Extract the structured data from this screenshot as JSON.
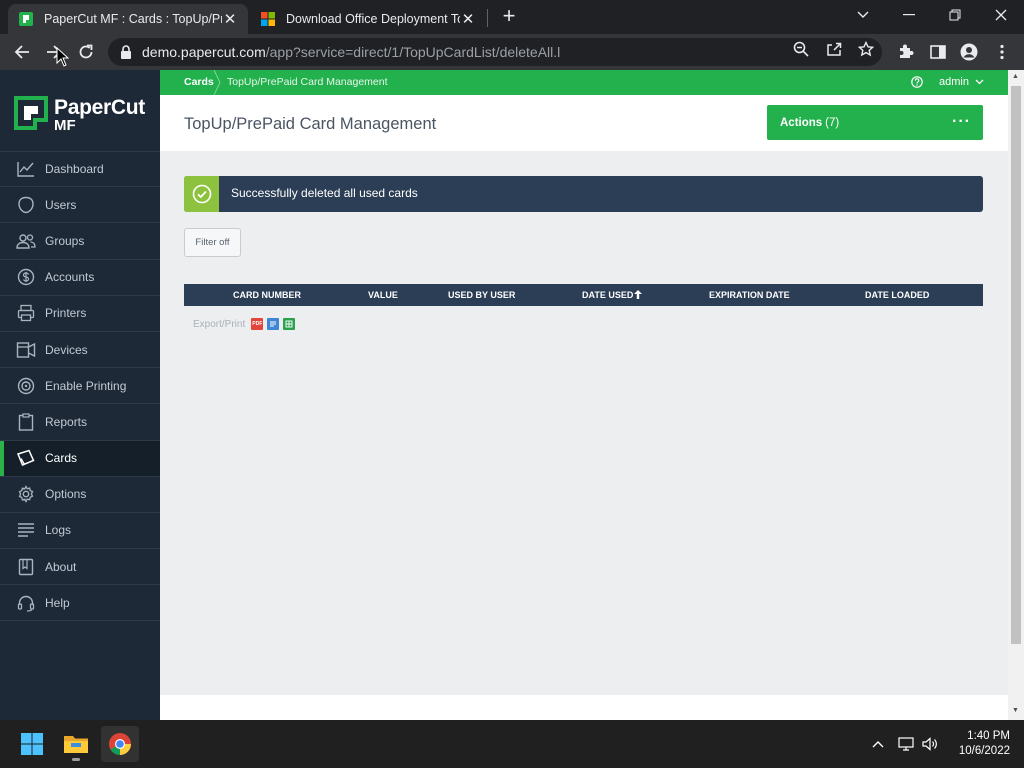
{
  "browser": {
    "tabs": [
      {
        "title": "PaperCut MF : Cards : TopUp/Pre",
        "active": true
      },
      {
        "title": "Download Office Deployment To",
        "active": false
      }
    ],
    "url_host": "demo.papercut.com",
    "url_path": "/app?service=direct/1/TopUpCardList/deleteAll.l"
  },
  "app": {
    "logo_word1": "PaperCut",
    "logo_word2": "MF",
    "sidebar": {
      "items": [
        {
          "label": "Dashboard",
          "icon": "dashboard-icon"
        },
        {
          "label": "Users",
          "icon": "users-icon"
        },
        {
          "label": "Groups",
          "icon": "groups-icon"
        },
        {
          "label": "Accounts",
          "icon": "accounts-icon"
        },
        {
          "label": "Printers",
          "icon": "printer-icon"
        },
        {
          "label": "Devices",
          "icon": "device-icon"
        },
        {
          "label": "Enable Printing",
          "icon": "enable-printing-icon"
        },
        {
          "label": "Reports",
          "icon": "reports-icon"
        },
        {
          "label": "Cards",
          "icon": "cards-icon",
          "active": true
        },
        {
          "label": "Options",
          "icon": "gear-icon"
        },
        {
          "label": "Logs",
          "icon": "logs-icon"
        },
        {
          "label": "About",
          "icon": "about-icon"
        },
        {
          "label": "Help",
          "icon": "help-icon"
        }
      ]
    },
    "breadcrumb": {
      "root": "Cards",
      "current": "TopUp/PrePaid Card Management"
    },
    "user_menu": "admin",
    "page_title": "TopUp/PrePaid Card Management",
    "actions": {
      "label": "Actions",
      "count": "(7)"
    },
    "alert_message": "Successfully deleted all used cards",
    "filter_button": "Filter off",
    "table": {
      "columns": [
        "CARD NUMBER",
        "VALUE",
        "USED BY USER",
        "DATE USED",
        "EXPIRATION DATE",
        "DATE LOADED"
      ],
      "sorted_column": "DATE USED",
      "rows": []
    },
    "export_label": "Export/Print",
    "export_pdf": "PDF"
  },
  "taskbar": {
    "time": "1:40 PM",
    "date": "10/6/2022"
  },
  "colors": {
    "brand_green": "#22b14c",
    "sidebar_bg": "#1d2937",
    "table_header": "#2b3e55",
    "success_check": "#8dc23f"
  }
}
